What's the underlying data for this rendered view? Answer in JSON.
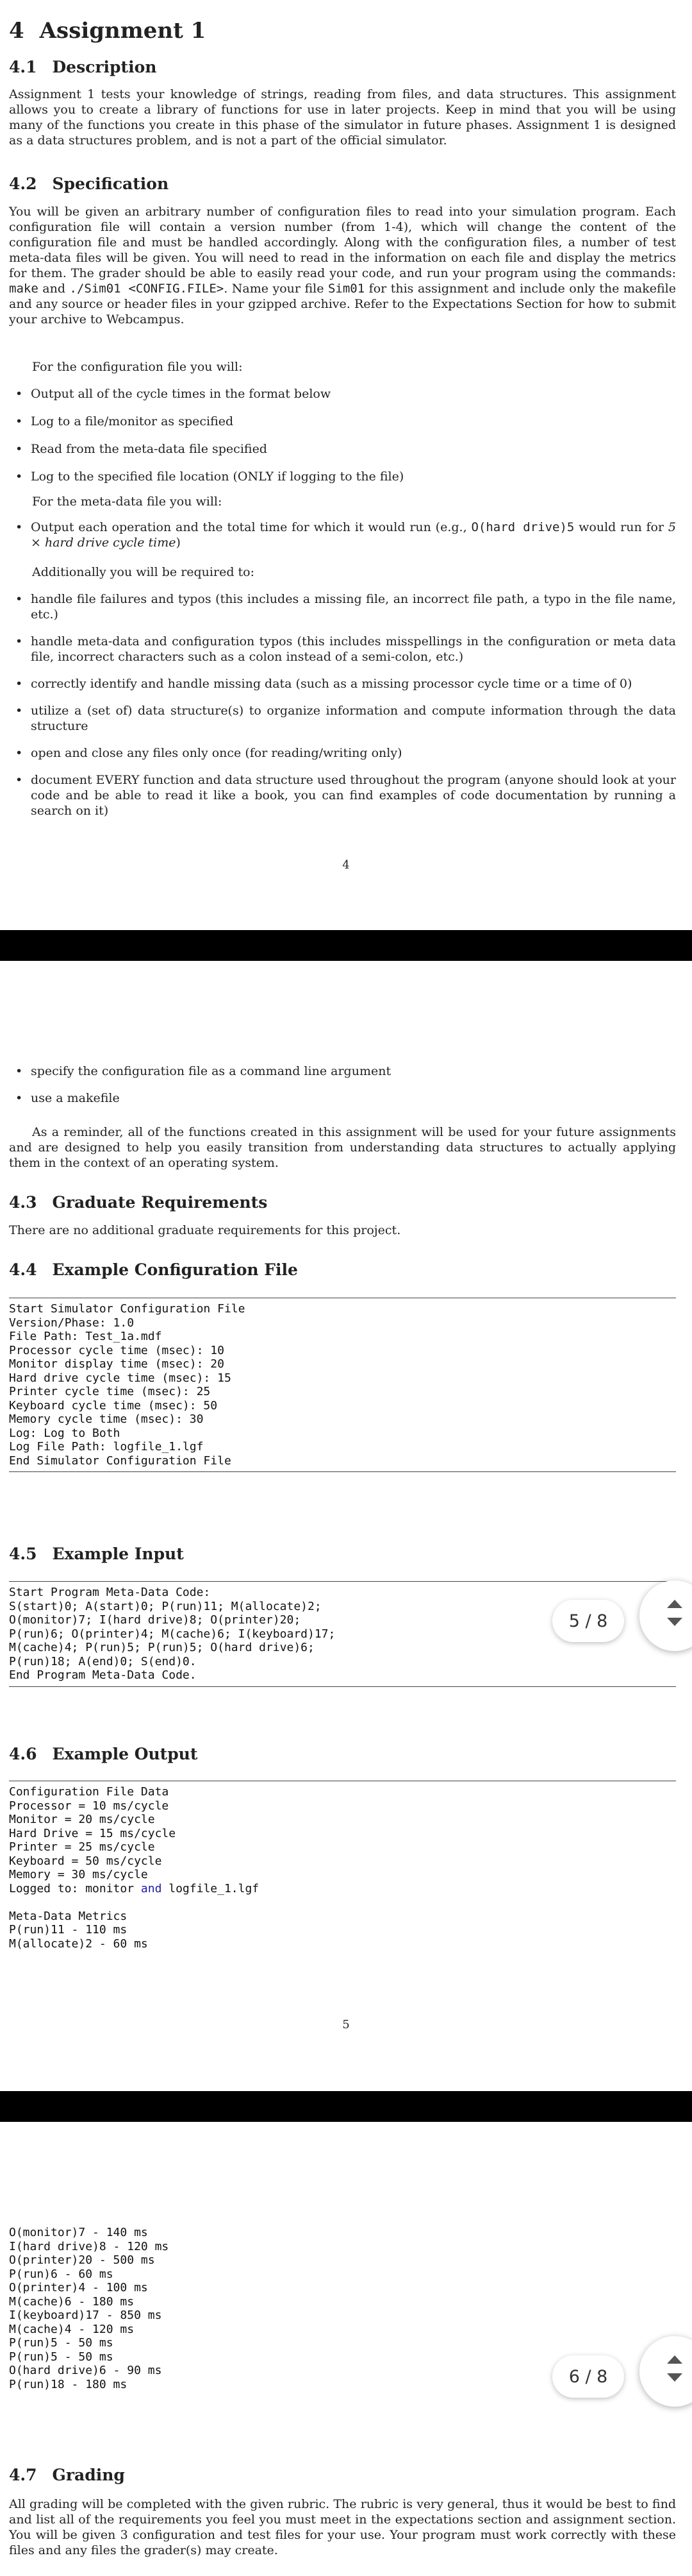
{
  "section": {
    "num": "4",
    "title": "Assignment 1"
  },
  "desc": {
    "num": "4.1",
    "title": "Description",
    "text": "Assignment 1 tests your knowledge of strings, reading from files, and data structures. This assignment allows you to create a library of functions for use in later projects. Keep in mind that you will be using many of the functions you create in this phase of the simulator in future phases. Assignment 1 is designed as a data structures problem, and is not a part of the official simulator."
  },
  "spec": {
    "num": "4.2",
    "title": "Specification",
    "text_a": "You will be given an arbitrary number of configuration files to read into your simulation program. Each configuration file will contain a version number (from 1-4), which will change the content of the configuration file and must be handled accordingly. Along with the configuration files, a number of test meta-data files will be given. You will need to read in the information on each file and display the metrics for them. The grader should be able to easily read your code, and run your program using the commands: ",
    "cmd_make": "make",
    "text_and": " and ",
    "cmd_run": "./Sim01 <CONFIG.FILE>",
    "text_b": ". Name your file ",
    "name": "Sim01",
    "text_c": " for this assignment and include only the makefile and any source or header files in your gzipped archive. Refer to the Expectations Section for how to submit your archive to Webcampus.",
    "config_intro": "For the configuration file you will:",
    "config_items": [
      "Output all of the cycle times in the format below",
      "Log to a file/monitor as specified",
      "Read from the meta-data file specified",
      "Log to the specified file location (ONLY if logging to the file)"
    ],
    "meta_intro": "For the meta-data file you will:",
    "meta_a": "Output each operation and the total time for which it would run (e.g., ",
    "meta_code": "O(hard drive)5",
    "meta_b": " would run for ",
    "meta_c": "5 × hard drive cycle time",
    "meta_d": ")",
    "add_intro": "Additionally you will be required to:",
    "add_items": [
      "handle file failures and typos (this includes a missing file, an incorrect file path, a typo in the file name, etc.)",
      "handle meta-data and configuration typos (this includes misspellings in the configuration or meta data file, incorrect characters such as a colon instead of a semi-colon, etc.)",
      "correctly identify and handle missing data (such as a missing processor cycle time or a time of 0)",
      "utilize a (set of) data structure(s) to organize information and compute information through the data structure",
      "open and close any files only once (for reading/writing only)",
      "document EVERY function and data structure used throughout the program (anyone should look at your code and be able to read it like a book, you can find examples of code documentation by running a search on it)"
    ],
    "add_items_2": [
      "specify the configuration file as a command line argument",
      "use a makefile"
    ],
    "reminder": "As a reminder, all of the functions created in this assignment will be used for your future assignments and are designed to help you easily transition from understanding data structures to actually applying them in the context of an operating system."
  },
  "grad": {
    "num": "4.3",
    "title": "Graduate Requirements",
    "text": "There are no additional graduate requirements for this project."
  },
  "exconfig": {
    "num": "4.4",
    "title": "Example Configuration File",
    "lines": [
      "Start Simulator Configuration File",
      "Version/Phase: 1.0",
      "File Path: Test_1a.mdf",
      "Processor cycle time (msec): 10",
      "Monitor display time (msec): 20",
      "Hard drive cycle time (msec): 15",
      "Printer cycle time (msec): 25",
      "Keyboard cycle time (msec): 50",
      "Memory cycle time (msec): 30",
      "Log: Log to Both",
      "Log File Path: logfile_1.lgf",
      "End Simulator Configuration File"
    ]
  },
  "exinput": {
    "num": "4.5",
    "title": "Example Input",
    "lines": [
      "Start Program Meta-Data Code:",
      "S(start)0; A(start)0; P(run)11; M(allocate)2;",
      "O(monitor)7; I(hard drive)8; O(printer)20;",
      "P(run)6; O(printer)4; M(cache)6; I(keyboard)17;",
      "M(cache)4; P(run)5; P(run)5; O(hard drive)6;",
      "P(run)18; A(end)0; S(end)0.",
      "End Program Meta-Data Code."
    ]
  },
  "exoutput": {
    "num": "4.6",
    "title": "Example Output",
    "lines": [
      "Configuration File Data",
      "Processor = 10 ms/cycle",
      "Monitor = 20 ms/cycle",
      "Hard Drive = 15 ms/cycle",
      "Printer = 25 ms/cycle",
      "Keyboard = 50 ms/cycle",
      "Memory = 30 ms/cycle"
    ],
    "logged_a": "Logged to: monitor ",
    "logged_kw": "and",
    "logged_b": " logfile_1.lgf",
    "meta_lines": [
      "Meta-Data Metrics",
      "P(run)11 - 110 ms",
      "M(allocate)2 - 60 ms"
    ],
    "cont_lines": [
      "O(monitor)7 - 140 ms",
      "I(hard drive)8 - 120 ms",
      "O(printer)20 - 500 ms",
      "P(run)6 - 60 ms",
      "O(printer)4 - 100 ms",
      "M(cache)6 - 180 ms",
      "I(keyboard)17 - 850 ms",
      "M(cache)4 - 120 ms",
      "P(run)5 - 50 ms",
      "P(run)5 - 50 ms",
      "O(hard drive)6 - 90 ms",
      "P(run)18 - 180 ms"
    ]
  },
  "grading": {
    "num": "4.7",
    "title": "Grading",
    "text": "All grading will be completed with the given rubric. The rubric is very general, thus it would be best to find and list all of the requirements you feel you must meet in the expectations section and assignment section. You will be given 3 configuration and test files for your use. Your program must work correctly with these files and any files the grader(s) may create."
  },
  "page_numbers": [
    "4",
    "5"
  ],
  "viewer": {
    "indicator_5": "5 / 8",
    "indicator_6": "6 / 8"
  }
}
